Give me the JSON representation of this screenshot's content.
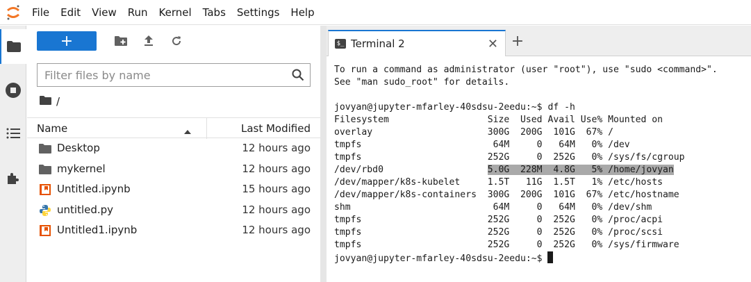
{
  "menu": [
    "File",
    "Edit",
    "View",
    "Run",
    "Kernel",
    "Tabs",
    "Settings",
    "Help"
  ],
  "filebrowser": {
    "new_label": "+",
    "search_placeholder": "Filter files by name",
    "breadcrumb": "/",
    "columns": {
      "name": "Name",
      "modified": "Last Modified"
    },
    "files": [
      {
        "name": "Desktop",
        "modified": "12 hours ago",
        "icon": "folder-icon"
      },
      {
        "name": "mykernel",
        "modified": "12 hours ago",
        "icon": "folder-icon"
      },
      {
        "name": "Untitled.ipynb",
        "modified": "15 hours ago",
        "icon": "notebook-icon"
      },
      {
        "name": "untitled.py",
        "modified": "12 hours ago",
        "icon": "python-icon"
      },
      {
        "name": "Untitled1.ipynb",
        "modified": "12 hours ago",
        "icon": "notebook-icon"
      }
    ]
  },
  "terminal": {
    "tab_label": "Terminal 2",
    "lines": [
      "To run a command as administrator (user \"root\"), use \"sudo <command>\".",
      "See \"man sudo_root\" for details.",
      "",
      "jovyan@jupyter-mfarley-40sdsu-2eedu:~$ df -h",
      "Filesystem                  Size  Used Avail Use% Mounted on",
      "overlay                     300G  200G  101G  67% /",
      "tmpfs                        64M     0   64M   0% /dev",
      "tmpfs                       252G     0  252G   0% /sys/fs/cgroup",
      "/dev/rbd0                   5.0G  228M  4.8G   5% /home/jovyan",
      "/dev/mapper/k8s-kubelet     1.5T   11G  1.5T   1% /etc/hosts",
      "/dev/mapper/k8s-containers  300G  200G  101G  67% /etc/hostname",
      "shm                          64M     0   64M   0% /dev/shm",
      "tmpfs                       252G     0  252G   0% /proc/acpi",
      "tmpfs                       252G     0  252G   0% /proc/scsi",
      "tmpfs                       252G     0  252G   0% /sys/firmware",
      "jovyan@jupyter-mfarley-40sdsu-2eedu:~$ "
    ],
    "highlight": {
      "line": 8,
      "prefix": "/dev/rbd0                   ",
      "text": "5.0G  228M  4.8G   5% /home/jovyan"
    }
  },
  "colors": {
    "accent": "#1976d2",
    "notebook_orange": "#e65100",
    "folder": "#616161"
  }
}
